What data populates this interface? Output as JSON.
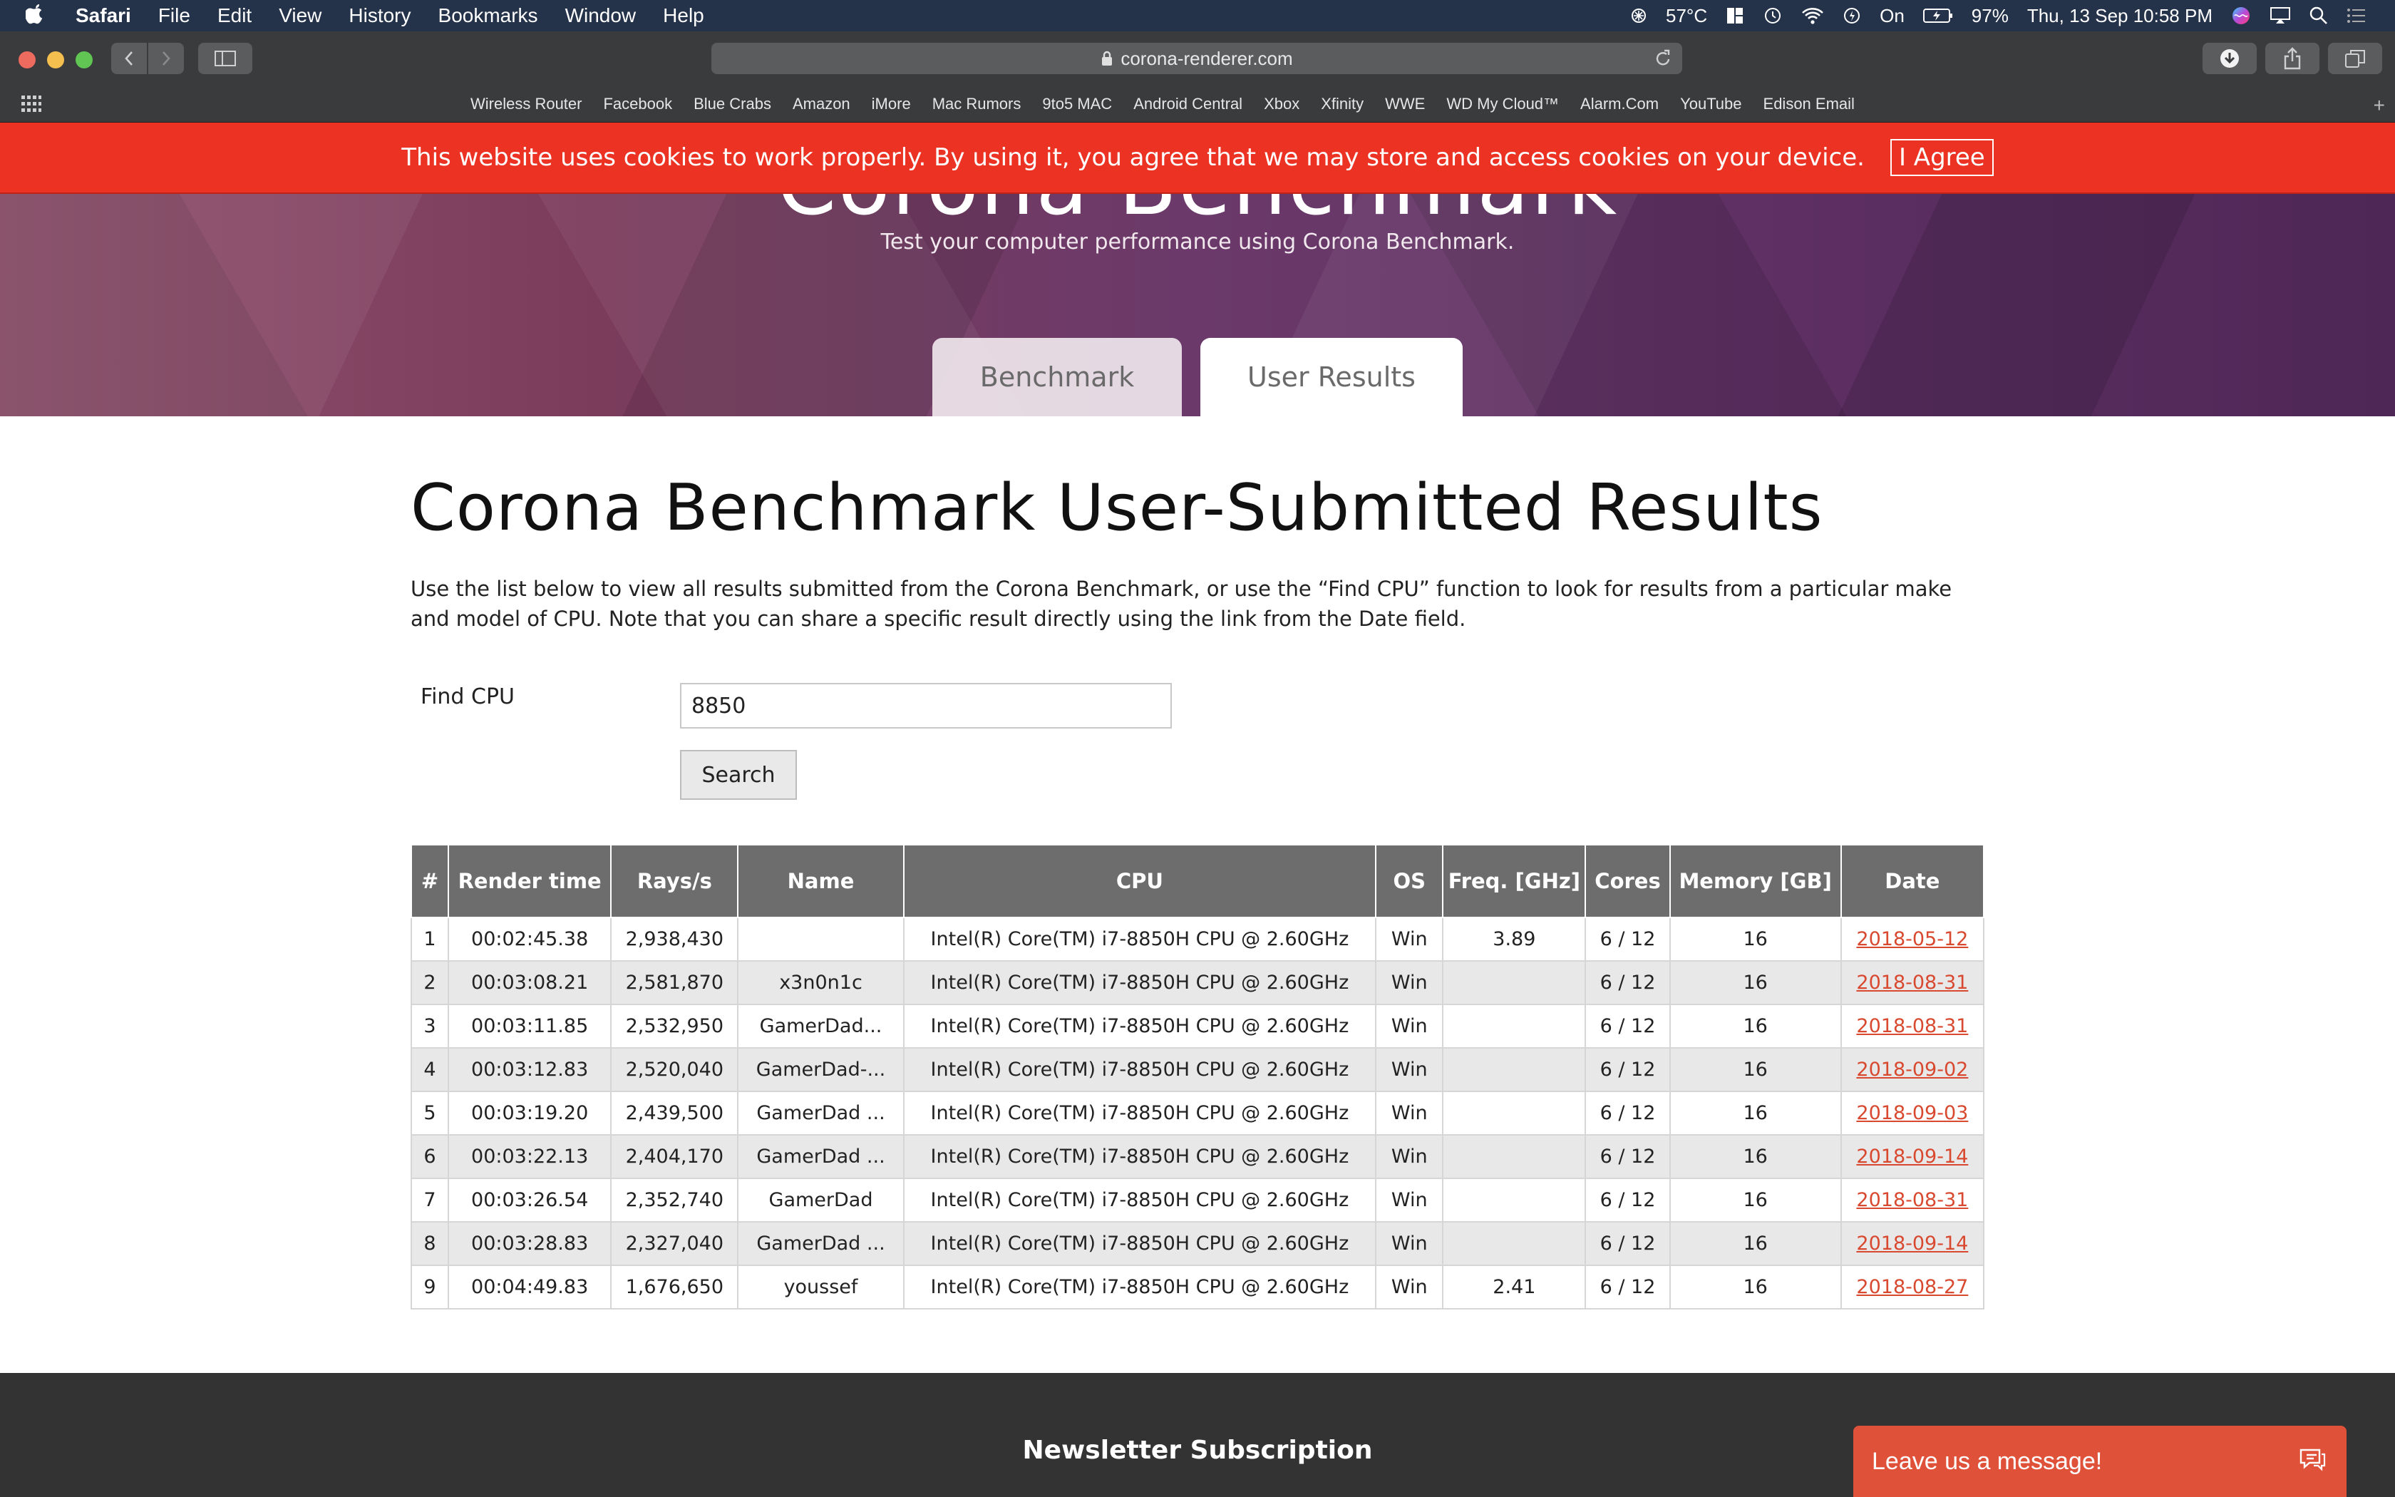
{
  "menubar": {
    "app_name": "Safari",
    "items": [
      "File",
      "Edit",
      "View",
      "History",
      "Bookmarks",
      "Window",
      "Help"
    ],
    "temperature": "57°C",
    "battery_state": "On",
    "battery_percent": "97%",
    "datetime": "Thu, 13 Sep 10:58 PM"
  },
  "browser": {
    "url": "corona-renderer.com",
    "favorites": [
      "Wireless Router",
      "Facebook",
      "Blue Crabs",
      "Amazon",
      "iMore",
      "Mac Rumors",
      "9to5 MAC",
      "Android Central",
      "Xbox",
      "Xfinity",
      "WWE",
      "WD My Cloud™",
      "Alarm.Com",
      "YouTube",
      "Edison Email"
    ]
  },
  "cookie_banner": {
    "text": "This website uses cookies to work properly. By using it, you agree that we may store and access cookies on your device.",
    "agree_label": "I Agree"
  },
  "hero": {
    "title": "Corona Benchmark",
    "subtitle": "Test your computer performance using Corona Benchmark.",
    "tabs": [
      "Benchmark",
      "User Results"
    ],
    "active_tab": "User Results"
  },
  "main": {
    "title": "Corona Benchmark User-Submitted Results",
    "intro": "Use the list below to view all results submitted from the Corona Benchmark, or use the “Find CPU” function to look for results from a particular make and model of CPU. Note that you can share a specific result directly using the link from the Date field.",
    "find_label": "Find CPU",
    "find_value": "8850",
    "search_label": "Search"
  },
  "table": {
    "headers": [
      "#",
      "Render time",
      "Rays/s",
      "Name",
      "CPU",
      "OS",
      "Freq. [GHz]",
      "Cores",
      "Memory [GB]",
      "Date"
    ],
    "rows": [
      [
        "1",
        "00:02:45.38",
        "2,938,430",
        "",
        "Intel(R) Core(TM) i7-8850H CPU @ 2.60GHz",
        "Win",
        "3.89",
        "6 / 12",
        "16",
        "2018-05-12"
      ],
      [
        "2",
        "00:03:08.21",
        "2,581,870",
        "x3n0n1c",
        "Intel(R) Core(TM) i7-8850H CPU @ 2.60GHz",
        "Win",
        "",
        "6 / 12",
        "16",
        "2018-08-31"
      ],
      [
        "3",
        "00:03:11.85",
        "2,532,950",
        "GamerDad...",
        "Intel(R) Core(TM) i7-8850H CPU @ 2.60GHz",
        "Win",
        "",
        "6 / 12",
        "16",
        "2018-08-31"
      ],
      [
        "4",
        "00:03:12.83",
        "2,520,040",
        "GamerDad-...",
        "Intel(R) Core(TM) i7-8850H CPU @ 2.60GHz",
        "Win",
        "",
        "6 / 12",
        "16",
        "2018-09-02"
      ],
      [
        "5",
        "00:03:19.20",
        "2,439,500",
        "GamerDad ...",
        "Intel(R) Core(TM) i7-8850H CPU @ 2.60GHz",
        "Win",
        "",
        "6 / 12",
        "16",
        "2018-09-03"
      ],
      [
        "6",
        "00:03:22.13",
        "2,404,170",
        "GamerDad ...",
        "Intel(R) Core(TM) i7-8850H CPU @ 2.60GHz",
        "Win",
        "",
        "6 / 12",
        "16",
        "2018-09-14"
      ],
      [
        "7",
        "00:03:26.54",
        "2,352,740",
        "GamerDad",
        "Intel(R) Core(TM) i7-8850H CPU @ 2.60GHz",
        "Win",
        "",
        "6 / 12",
        "16",
        "2018-08-31"
      ],
      [
        "8",
        "00:03:28.83",
        "2,327,040",
        "GamerDad ...",
        "Intel(R) Core(TM) i7-8850H CPU @ 2.60GHz",
        "Win",
        "",
        "6 / 12",
        "16",
        "2018-09-14"
      ],
      [
        "9",
        "00:04:49.83",
        "1,676,650",
        "youssef",
        "Intel(R) Core(TM) i7-8850H CPU @ 2.60GHz",
        "Win",
        "2.41",
        "6 / 12",
        "16",
        "2018-08-27"
      ]
    ]
  },
  "footer": {
    "newsletter_title": "Newsletter Subscription",
    "chat_label": "Leave us a message!"
  },
  "icons": {
    "apple": "apple-icon",
    "wifi": "wifi-icon",
    "battery": "battery-icon",
    "search": "search-icon",
    "lock": "lock-icon",
    "reload": "reload-icon",
    "chat": "chat-icon"
  },
  "colors": {
    "cookie_banner": "#eb3223",
    "date_link": "#d8492f",
    "table_header": "#6d6d6d",
    "chat_button": "#e0513a",
    "footer": "#333333"
  }
}
